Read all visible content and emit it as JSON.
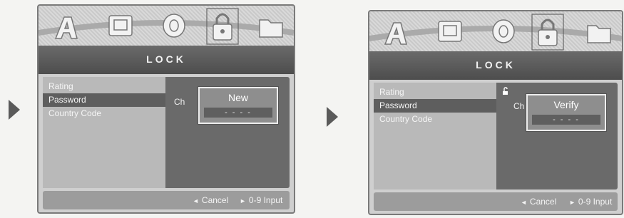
{
  "screens": [
    {
      "title": "LOCK",
      "menu_items": [
        "Rating",
        "Password",
        "Country Code"
      ],
      "selected_index": 1,
      "change_label_partial": "Ch",
      "dialog": {
        "title": "New",
        "code_placeholder": "- - - -"
      },
      "lock_indicator": "",
      "footer": {
        "cancel": "Cancel",
        "input": "0-9 Input"
      }
    },
    {
      "title": "LOCK",
      "menu_items": [
        "Rating",
        "Password",
        "Country Code"
      ],
      "selected_index": 1,
      "change_label_partial": "Ch",
      "dialog": {
        "title": "Verify",
        "code_placeholder": "- - - -"
      },
      "lock_indicator": "unlock-icon",
      "footer": {
        "cancel": "Cancel",
        "input": "0-9 Input"
      }
    }
  ],
  "icons": [
    "a-icon",
    "picture-icon",
    "disc-icon",
    "lock-icon",
    "folder-icon"
  ],
  "footer_glyphs": {
    "cancel": "◄",
    "input": "►"
  },
  "colors": {
    "title_bar": "#4d4d4d",
    "menu_selected": "#5e5e5e",
    "dialog": "#8e8e8e"
  }
}
